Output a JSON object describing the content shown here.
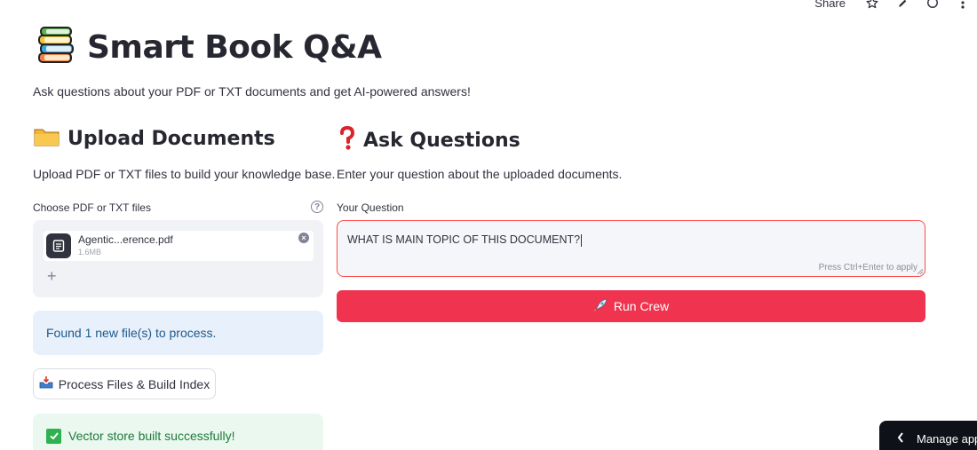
{
  "topbar": {
    "share_label": "Share"
  },
  "header": {
    "title": "Smart Book Q&A",
    "subtitle": "Ask questions about your PDF or TXT documents and get AI-powered answers!"
  },
  "upload": {
    "heading": "Upload Documents",
    "description": "Upload PDF or TXT files to build your knowledge base.",
    "field_label": "Choose PDF or TXT files",
    "file": {
      "name": "Agentic...erence.pdf",
      "size": "1.6MB"
    },
    "info_message": "Found 1 new file(s) to process.",
    "process_button": "Process Files & Build Index",
    "success_message": "Vector store built successfully!"
  },
  "ask": {
    "heading": "Ask Questions",
    "description": "Enter your question about the uploaded documents.",
    "field_label": "Your Question",
    "question_value": "WHAT IS MAIN TOPIC OF THIS DOCUMENT?",
    "hint": "Press Ctrl+Enter to apply",
    "run_button": "Run Crew"
  },
  "manage_app": {
    "label": "Manage app"
  },
  "colors": {
    "primary": "#f0334e",
    "info_bg": "#e8f0fc",
    "success_bg": "#eaf8ef",
    "focus_border": "#ff4b4b"
  }
}
